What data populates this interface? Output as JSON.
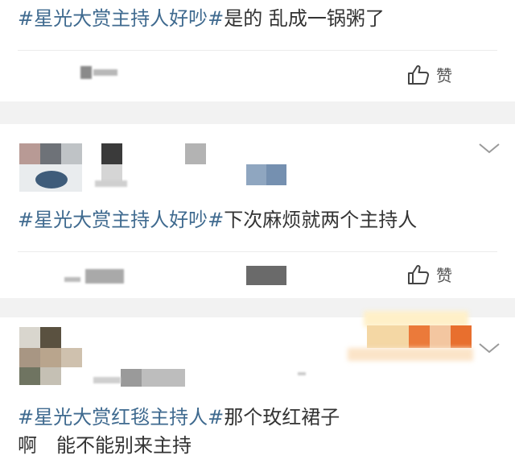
{
  "posts": [
    {
      "hashtag": "#星光大赏主持人好吵#",
      "text": "是的 乱成一锅粥了",
      "like_label": "赞"
    },
    {
      "hashtag": "#星光大赏主持人好吵#",
      "text": "下次麻烦就两个主持人",
      "like_label": "赞"
    },
    {
      "hashtag": "#星光大赏红毯主持人#",
      "text": "那个玫红裙子",
      "text_line2": "啊　能不能别来主持"
    }
  ],
  "icons": {
    "like": "thumbs-up-icon",
    "expand": "chevron-down-icon"
  },
  "colors": {
    "hashtag": "#3f6a8f",
    "background_gap": "#f2f2f2",
    "text": "#333333"
  }
}
